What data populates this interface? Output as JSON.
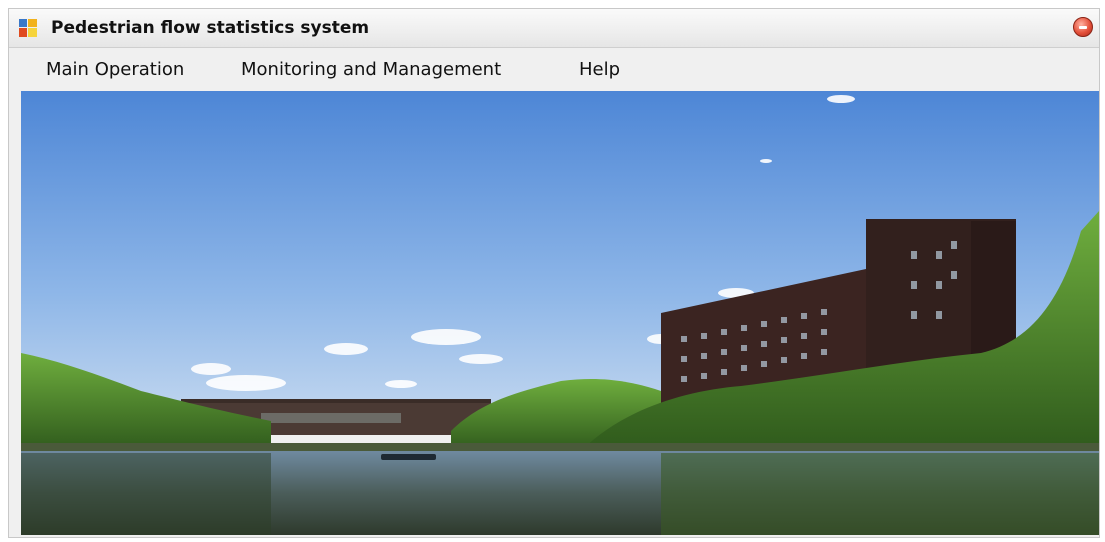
{
  "window": {
    "title": "Pedestrian flow statistics system",
    "app_icon": "app-logo-icon",
    "close_icon": "close-icon"
  },
  "menu": {
    "items": [
      {
        "label": "Main Operation"
      },
      {
        "label": "Monitoring and Management"
      },
      {
        "label": "Help"
      }
    ]
  },
  "image": {
    "subject": "campus-lake-landscape-photo"
  }
}
